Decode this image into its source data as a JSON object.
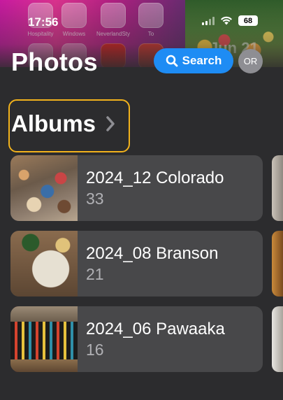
{
  "status_bar": {
    "time": "17:56",
    "battery": "68"
  },
  "home_screen_labels": [
    "Hospitality",
    "Windows",
    "NeverlandSty",
    "To"
  ],
  "header": {
    "title": "Photos",
    "search_label": "Search",
    "avatar_initials": "OR",
    "memory_date": "Jun 21"
  },
  "albums": {
    "title": "Albums",
    "items": [
      {
        "name": "2024_12 Colorado",
        "count": "33"
      },
      {
        "name": "2024_08 Branson",
        "count": "21"
      },
      {
        "name": "2024_06 Pawaaka",
        "count": "16"
      }
    ]
  },
  "colors": {
    "background": "#2c2c2e",
    "card": "#48484a",
    "accent_blue": "#1e8cf4",
    "focus_ring": "#f2b21c"
  }
}
